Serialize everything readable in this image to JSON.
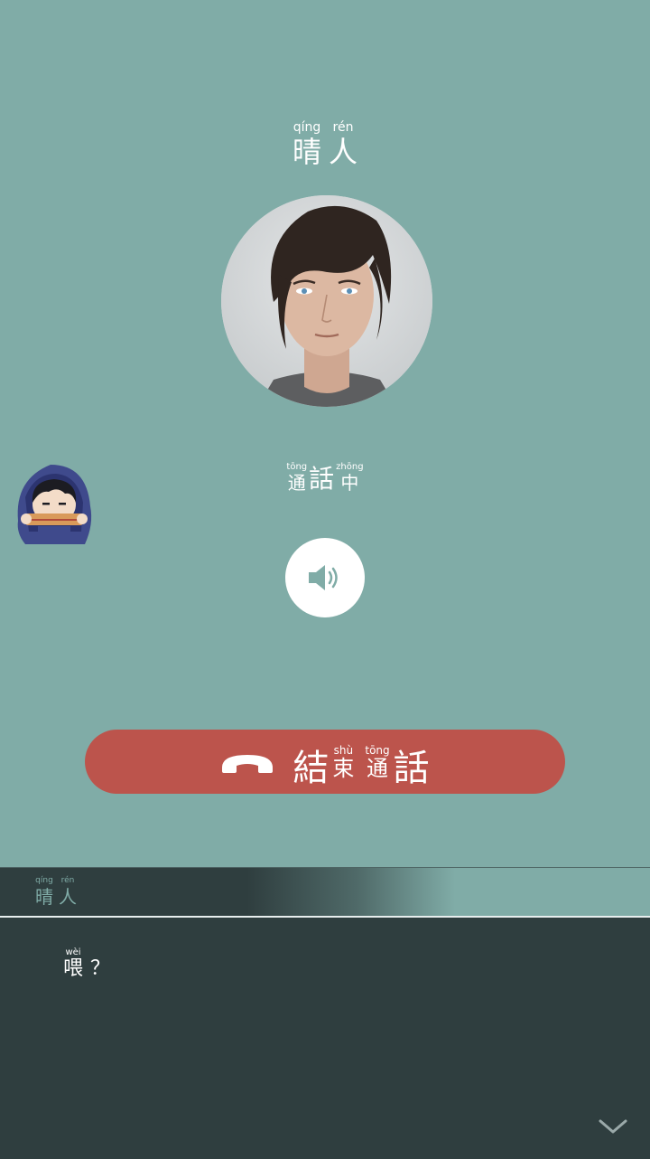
{
  "caller": {
    "name": [
      {
        "pinyin": "qíng",
        "char": "晴"
      },
      {
        "pinyin": "rén",
        "char": "人"
      }
    ]
  },
  "call": {
    "status": [
      {
        "pinyin": "tōng",
        "char": "通"
      },
      {
        "pinyin": "",
        "char": "話"
      },
      {
        "pinyin": "zhōng",
        "char": "中"
      }
    ],
    "speaker_icon": "speaker-icon",
    "end_call": {
      "icon": "phone-hangup-icon",
      "label": [
        {
          "pinyin": "",
          "char": "結"
        },
        {
          "pinyin": "shù",
          "char": "束"
        },
        {
          "pinyin": "tōng",
          "char": "通"
        },
        {
          "pinyin": "",
          "char": "話"
        }
      ]
    }
  },
  "dialogue": {
    "speaker": [
      {
        "pinyin": "qíng",
        "char": "晴"
      },
      {
        "pinyin": "rén",
        "char": "人"
      }
    ],
    "line": {
      "pinyin": "wèi",
      "char": "喂",
      "punct": "？"
    },
    "advance_icon": "chevron-down-icon"
  },
  "colors": {
    "background": "#80aca7",
    "end_call": "#bc544c",
    "dialog": "#2f3e3f"
  }
}
